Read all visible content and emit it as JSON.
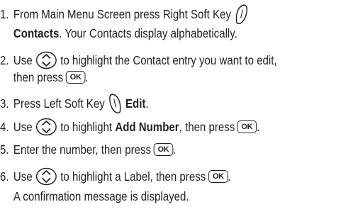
{
  "steps": [
    {
      "number": "1.",
      "text_a": "From Main Menu Screen press Right Soft Key",
      "bold": "Contacts",
      "text_b": ". Your Contacts display alphabetically."
    },
    {
      "number": "2.",
      "text_a": "Use",
      "text_b": "to highlight the Contact entry you want to edit,",
      "text_c": "then press",
      "text_d": "."
    },
    {
      "number": "3.",
      "text_a": "Press Left Soft Key",
      "bold": "Edit",
      "text_b": "."
    },
    {
      "number": "4.",
      "text_a": "Use",
      "text_b": "to highlight",
      "bold": "Add Number",
      "text_c": ", then press",
      "text_d": "."
    },
    {
      "number": "5.",
      "text_a": "Enter the number, then press",
      "text_b": "."
    },
    {
      "number": "6.",
      "text_a": "Use",
      "text_b": "to highlight a Label, then press",
      "text_c": ".",
      "note": "A confirmation message is displayed."
    }
  ],
  "ok_key_label": "OK",
  "icons": {
    "right_soft_key": "right-soft-key-icon",
    "left_soft_key": "left-soft-key-icon",
    "navigation_key": "up-down-navigation-key-icon",
    "ok_key": "ok-key-icon"
  }
}
